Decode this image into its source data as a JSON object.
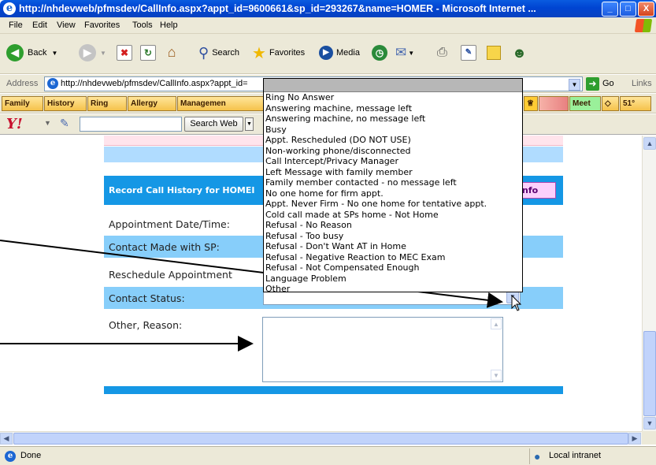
{
  "window": {
    "title": "http://nhdevweb/pfmsdev/CallInfo.aspx?appt_id=9600661&sp_id=293267&name=HOMER - Microsoft Internet ...",
    "min": "_",
    "max": "□",
    "close": "X"
  },
  "menu": [
    "File",
    "Edit",
    "View",
    "Favorites",
    "Tools",
    "Help"
  ],
  "toolbar": {
    "back": "Back",
    "search": "Search",
    "favorites": "Favorites",
    "media": "Media"
  },
  "address": {
    "label": "Address",
    "url": "http://nhdevweb/pfmsdev/CallInfo.aspx?appt_id=",
    "go": "Go",
    "links": "Links"
  },
  "links_bar": [
    "Family",
    "History",
    "Ring",
    "Allergy",
    "Managemen"
  ],
  "links_bar_right": {
    "meet": "Meet",
    "temp": "51°"
  },
  "yahoo": {
    "logo": "Y!",
    "search_button": "Search Web"
  },
  "form": {
    "header": "Record Call History for HOMEI",
    "info_button": "nfo",
    "appointment_label": "Appointment Date/Time:",
    "contact_made_label": "Contact Made with SP:",
    "reschedule_label": "Reschedule Appointment",
    "contact_status_label": "Contact Status:",
    "other_reason_label": "Other, Reason:"
  },
  "dropdown_options": [
    "Ring No Answer",
    "Answering machine, message left",
    "Answering machine, no message left",
    "Busy",
    "Appt. Rescheduled (DO NOT USE)",
    "Non-working phone/disconnected",
    "Call Intercept/Privacy Manager",
    "Left Message with family member",
    "Family member contacted - no message left",
    "No one home for firm appt.",
    "Appt. Never Firm - No one home for tentative appt.",
    "Cold call made at SPs home - Not Home",
    "Refusal - No Reason",
    "Refusal - Too busy",
    "Refusal - Don't Want AT in Home",
    "Refusal - Negative Reaction to MEC Exam",
    "Refusal - Not Compensated Enough",
    "Language Problem",
    "Other"
  ],
  "status": {
    "left": "Done",
    "right": "Local intranet"
  },
  "colors": {
    "header_blue": "#1597e5",
    "row_blue": "#87cefa",
    "title_blue": "#0044d2",
    "chrome": "#ece9d8"
  }
}
